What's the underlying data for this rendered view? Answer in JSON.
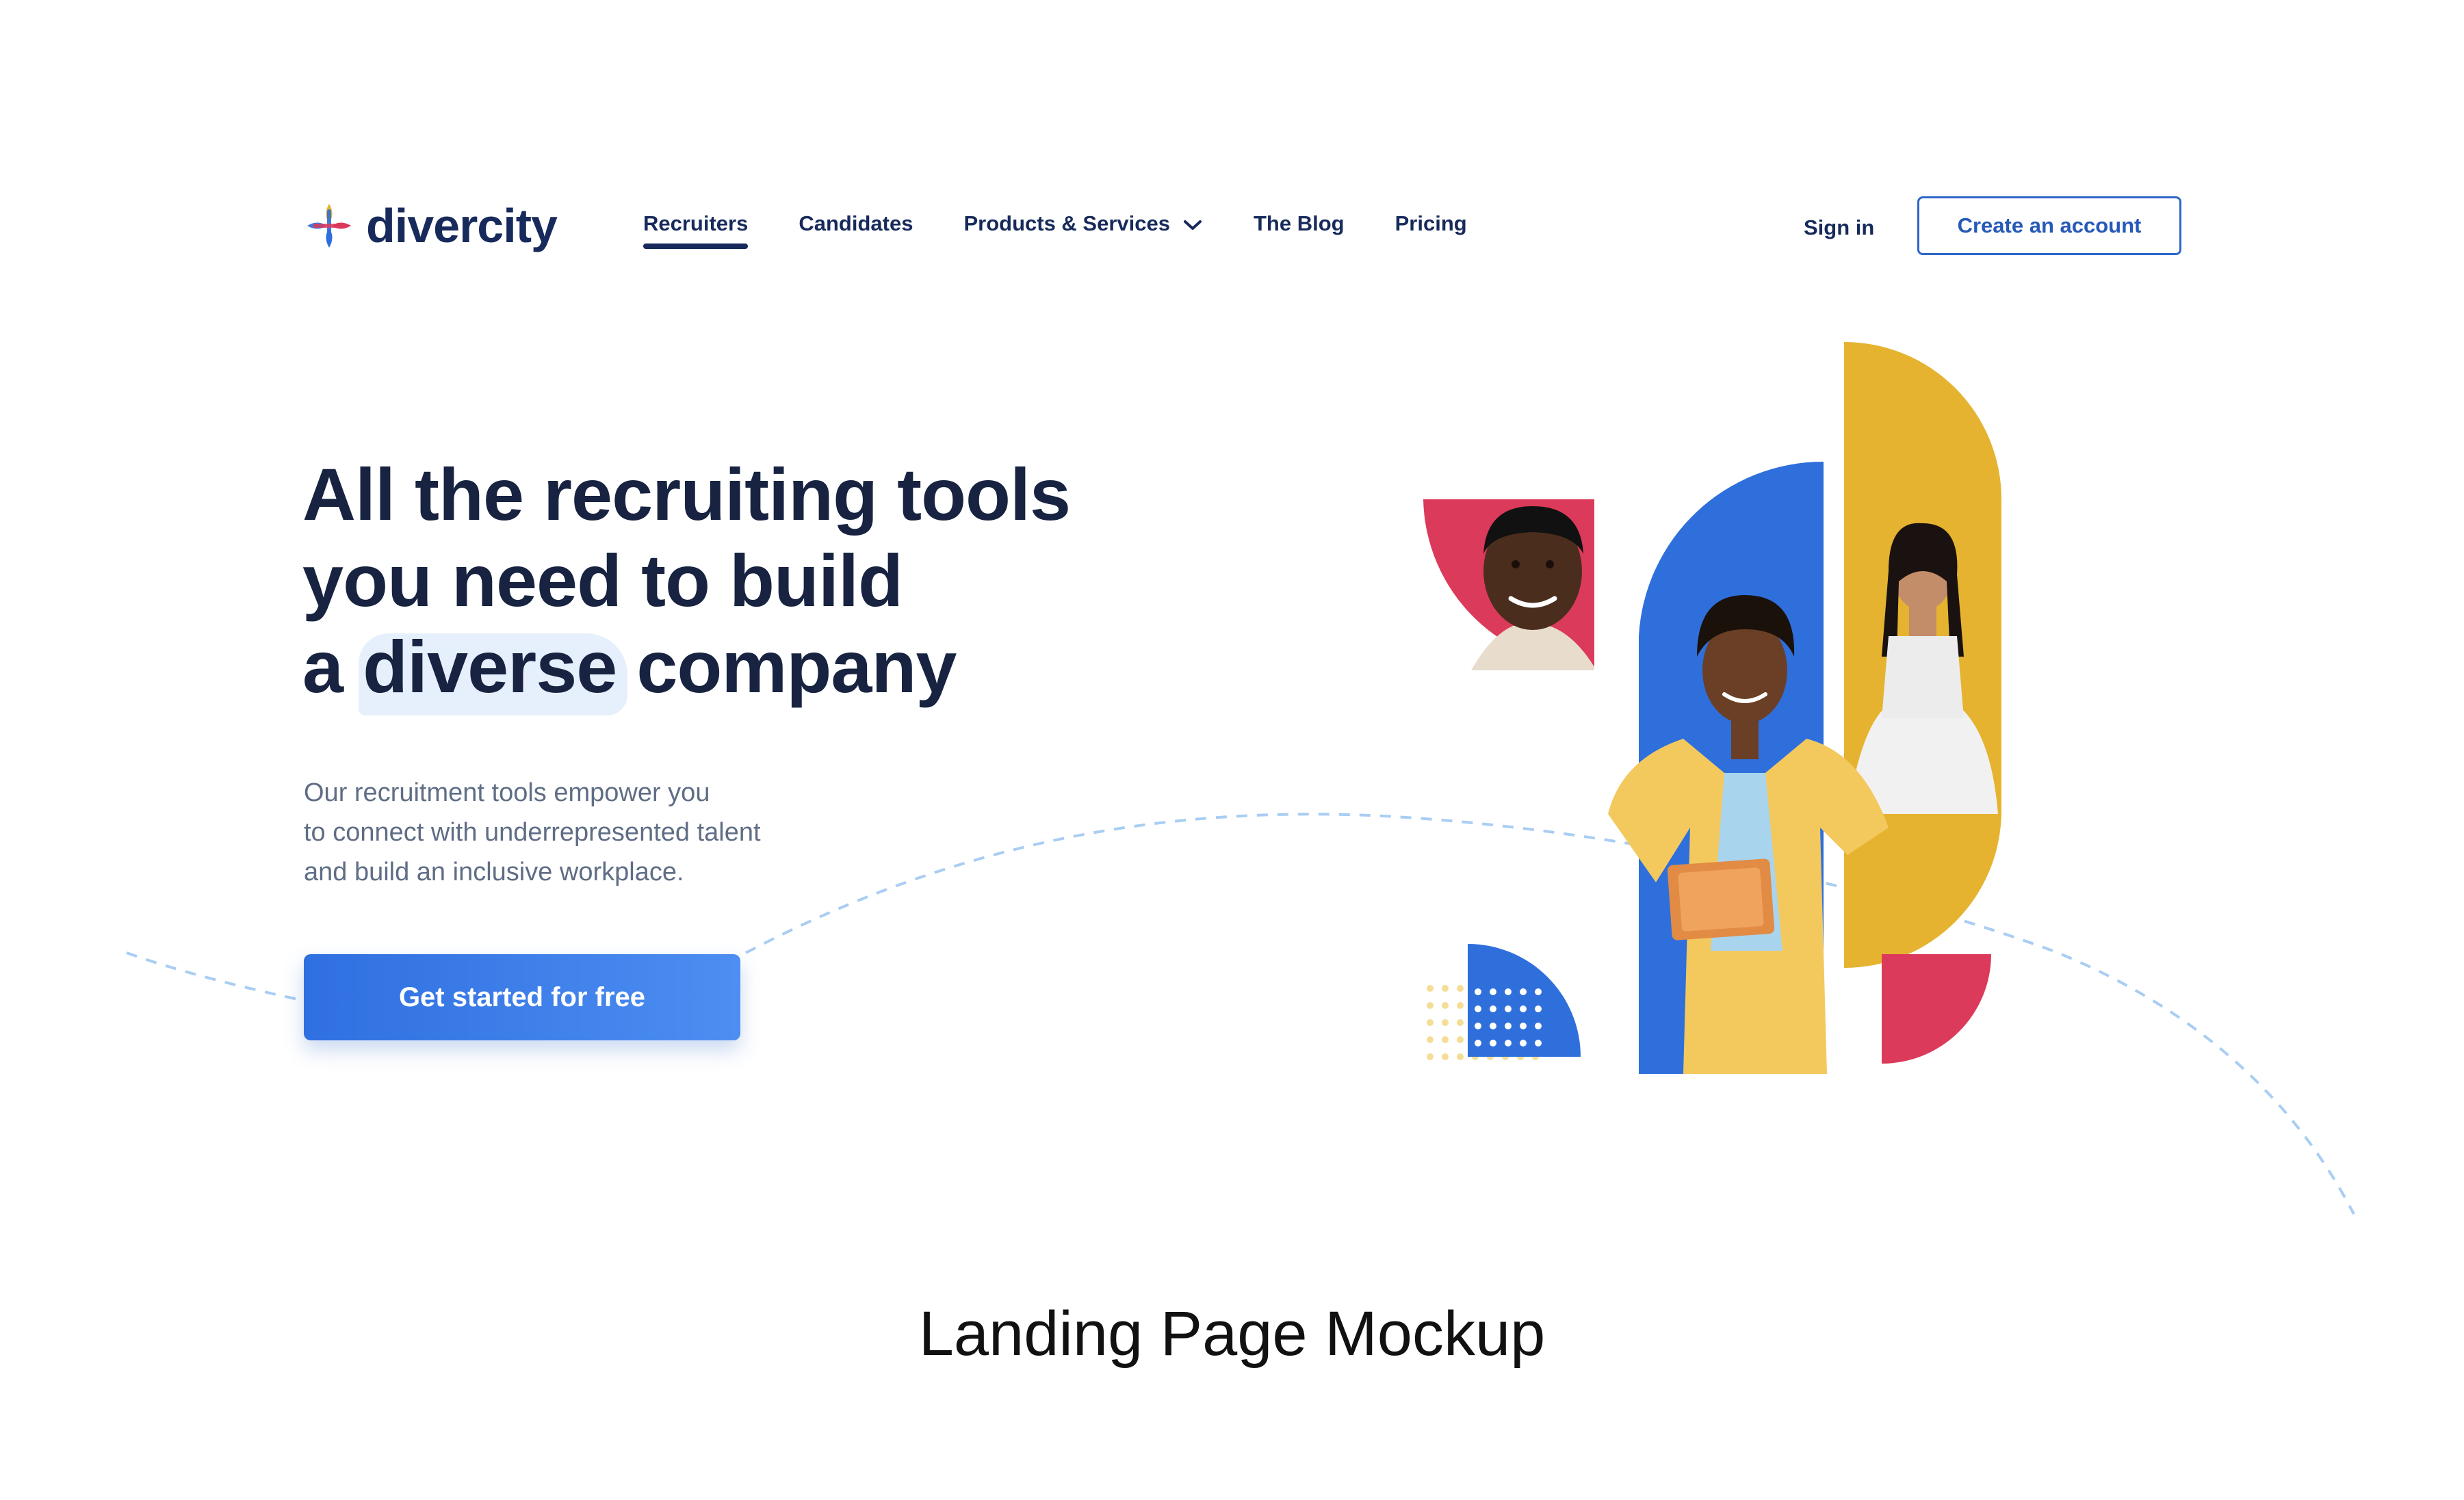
{
  "brand": {
    "name": "divercity",
    "colors": {
      "navy": "#172a5b",
      "blue": "#2e6fdc",
      "yellow": "#e5b32f",
      "red": "#db3a5a"
    }
  },
  "nav": {
    "items": [
      {
        "label": "Recruiters",
        "active": true
      },
      {
        "label": "Candidates",
        "active": false
      },
      {
        "label": "Products & Services",
        "active": false,
        "has_dropdown": true
      },
      {
        "label": "The Blog",
        "active": false
      },
      {
        "label": "Pricing",
        "active": false
      }
    ]
  },
  "auth": {
    "sign_in": "Sign in",
    "create_account": "Create an account"
  },
  "hero": {
    "headline_lines": [
      "All the recruiting tools",
      "you need to build"
    ],
    "headline_l3_pre": "a ",
    "headline_highlight": "diverse",
    "headline_l3_post": " company",
    "subtext_lines": [
      "Our recruitment tools empower you",
      "to connect with underrepresented talent",
      "and build an inclusive workplace."
    ],
    "cta": "Get started for free"
  },
  "caption": "Landing Page Mockup",
  "icons": [
    "divercity-logo-icon",
    "chevron-down-icon"
  ]
}
